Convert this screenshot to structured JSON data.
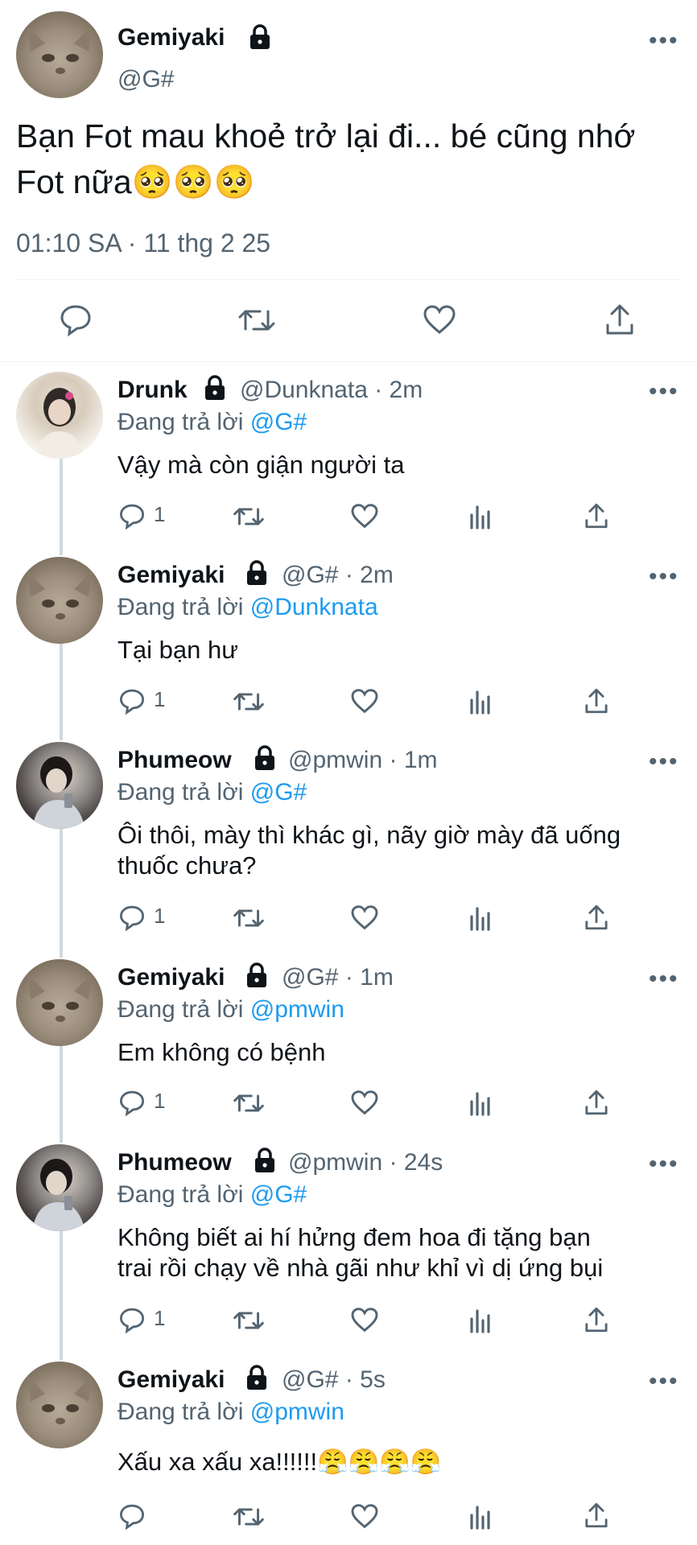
{
  "main_tweet": {
    "display_name": "Gemiyaki",
    "handle": "@G#",
    "text_line1": "Bạn Fot mau khoẻ trở lại đi... bé cũng nhớ",
    "text_line2": "Fot nữa🥺🥺🥺",
    "timestamp": "01:10 SA · 11 thg 2 25",
    "more": "•••"
  },
  "replies": [
    {
      "display_name": "Drunk",
      "handle": "@Dunknata",
      "time": "· 2m",
      "replying_label": "Đang trả lời",
      "replying_to": "@G#",
      "lines": [
        "Vậy mà còn giận người ta"
      ],
      "reply_count": "1",
      "more": "•••"
    },
    {
      "display_name": "Gemiyaki",
      "handle": "@G#",
      "time": "· 2m",
      "replying_label": "Đang trả lời",
      "replying_to": "@Dunknata",
      "lines": [
        "Tại bạn hư"
      ],
      "reply_count": "1",
      "more": "•••"
    },
    {
      "display_name": "Phumeow",
      "handle": "@pmwin",
      "time": "· 1m",
      "replying_label": "Đang trả lời",
      "replying_to": "@G#",
      "lines": [
        "Ôi thôi, mày thì khác gì, nãy giờ mày đã uống",
        "thuốc chưa?"
      ],
      "reply_count": "1",
      "more": "•••"
    },
    {
      "display_name": "Gemiyaki",
      "handle": "@G#",
      "time": "· 1m",
      "replying_label": "Đang trả lời",
      "replying_to": "@pmwin",
      "lines": [
        "Em không có bệnh"
      ],
      "reply_count": "1",
      "more": "•••"
    },
    {
      "display_name": "Phumeow",
      "handle": "@pmwin",
      "time": "· 24s",
      "replying_label": "Đang trả lời",
      "replying_to": "@G#",
      "lines": [
        "Không biết ai hí hửng đem hoa đi tặng bạn",
        "trai rồi chạy về nhà gãi như khỉ vì dị ứng bụi"
      ],
      "reply_count": "1",
      "more": "•••"
    },
    {
      "display_name": "Gemiyaki",
      "handle": "@G#",
      "time": "· 5s",
      "replying_label": "Đang trả lời",
      "replying_to": "@pmwin",
      "lines": [
        "Xấu xa xấu xa!!!!!!😤😤😤😤"
      ],
      "reply_count": "",
      "more": "•••"
    }
  ]
}
